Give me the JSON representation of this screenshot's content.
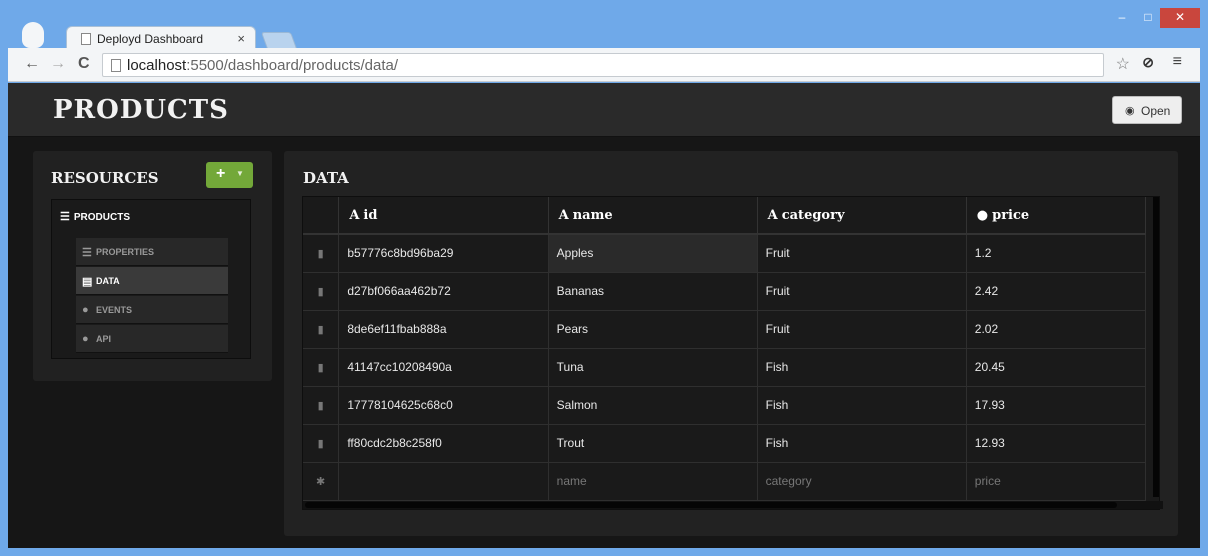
{
  "browser": {
    "tab_title": "Deployd Dashboard",
    "tab_close": "×",
    "url_host": "localhost",
    "url_rest": ":5500/dashboard/products/data/",
    "win_min": "‒",
    "win_max": "□",
    "win_close": "✕"
  },
  "header": {
    "title": "PRODUCTS",
    "open_label": "Open"
  },
  "resources": {
    "title": "RESOURCES",
    "add_label": "+",
    "root_label": "PRODUCTS",
    "items": [
      {
        "label": "PROPERTIES",
        "icon": "list-icon"
      },
      {
        "label": "DATA",
        "icon": "table-icon"
      },
      {
        "label": "EVENTS",
        "icon": "exclamation-icon"
      },
      {
        "label": "API",
        "icon": "info-icon"
      }
    ],
    "active": "DATA"
  },
  "data": {
    "title": "DATA",
    "columns": [
      {
        "type_marker": "A",
        "label": "id"
      },
      {
        "type_marker": "A",
        "label": "name"
      },
      {
        "type_marker": "A",
        "label": "category"
      },
      {
        "type_marker": "●",
        "label": "price"
      }
    ],
    "rows": [
      [
        "b57776c8bd96ba29",
        "Apples",
        "Fruit",
        "1.2"
      ],
      [
        "d27bf066aa462b72",
        "Bananas",
        "Fruit",
        "2.42"
      ],
      [
        "8de6ef11fbab888a",
        "Pears",
        "Fruit",
        "2.02"
      ],
      [
        "41147cc10208490a",
        "Tuna",
        "Fish",
        "20.45"
      ],
      [
        "17778104625c68c0",
        "Salmon",
        "Fish",
        "17.93"
      ],
      [
        "ff80cdc2b8c258f0",
        "Trout",
        "Fish",
        "12.93"
      ]
    ],
    "new_row": {
      "name_placeholder": "name",
      "category_placeholder": "category",
      "price_placeholder": "price"
    }
  }
}
